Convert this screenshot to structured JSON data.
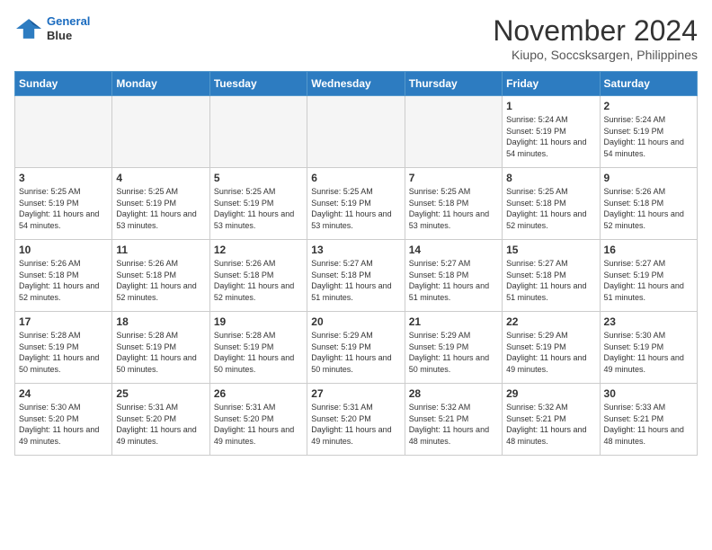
{
  "header": {
    "logo_line1": "General",
    "logo_line2": "Blue",
    "month": "November 2024",
    "location": "Kiupo, Soccsksargen, Philippines"
  },
  "weekdays": [
    "Sunday",
    "Monday",
    "Tuesday",
    "Wednesday",
    "Thursday",
    "Friday",
    "Saturday"
  ],
  "weeks": [
    [
      {
        "day": "",
        "info": ""
      },
      {
        "day": "",
        "info": ""
      },
      {
        "day": "",
        "info": ""
      },
      {
        "day": "",
        "info": ""
      },
      {
        "day": "",
        "info": ""
      },
      {
        "day": "1",
        "info": "Sunrise: 5:24 AM\nSunset: 5:19 PM\nDaylight: 11 hours\nand 54 minutes."
      },
      {
        "day": "2",
        "info": "Sunrise: 5:24 AM\nSunset: 5:19 PM\nDaylight: 11 hours\nand 54 minutes."
      }
    ],
    [
      {
        "day": "3",
        "info": "Sunrise: 5:25 AM\nSunset: 5:19 PM\nDaylight: 11 hours\nand 54 minutes."
      },
      {
        "day": "4",
        "info": "Sunrise: 5:25 AM\nSunset: 5:19 PM\nDaylight: 11 hours\nand 53 minutes."
      },
      {
        "day": "5",
        "info": "Sunrise: 5:25 AM\nSunset: 5:19 PM\nDaylight: 11 hours\nand 53 minutes."
      },
      {
        "day": "6",
        "info": "Sunrise: 5:25 AM\nSunset: 5:19 PM\nDaylight: 11 hours\nand 53 minutes."
      },
      {
        "day": "7",
        "info": "Sunrise: 5:25 AM\nSunset: 5:18 PM\nDaylight: 11 hours\nand 53 minutes."
      },
      {
        "day": "8",
        "info": "Sunrise: 5:25 AM\nSunset: 5:18 PM\nDaylight: 11 hours\nand 52 minutes."
      },
      {
        "day": "9",
        "info": "Sunrise: 5:26 AM\nSunset: 5:18 PM\nDaylight: 11 hours\nand 52 minutes."
      }
    ],
    [
      {
        "day": "10",
        "info": "Sunrise: 5:26 AM\nSunset: 5:18 PM\nDaylight: 11 hours\nand 52 minutes."
      },
      {
        "day": "11",
        "info": "Sunrise: 5:26 AM\nSunset: 5:18 PM\nDaylight: 11 hours\nand 52 minutes."
      },
      {
        "day": "12",
        "info": "Sunrise: 5:26 AM\nSunset: 5:18 PM\nDaylight: 11 hours\nand 52 minutes."
      },
      {
        "day": "13",
        "info": "Sunrise: 5:27 AM\nSunset: 5:18 PM\nDaylight: 11 hours\nand 51 minutes."
      },
      {
        "day": "14",
        "info": "Sunrise: 5:27 AM\nSunset: 5:18 PM\nDaylight: 11 hours\nand 51 minutes."
      },
      {
        "day": "15",
        "info": "Sunrise: 5:27 AM\nSunset: 5:18 PM\nDaylight: 11 hours\nand 51 minutes."
      },
      {
        "day": "16",
        "info": "Sunrise: 5:27 AM\nSunset: 5:19 PM\nDaylight: 11 hours\nand 51 minutes."
      }
    ],
    [
      {
        "day": "17",
        "info": "Sunrise: 5:28 AM\nSunset: 5:19 PM\nDaylight: 11 hours\nand 50 minutes."
      },
      {
        "day": "18",
        "info": "Sunrise: 5:28 AM\nSunset: 5:19 PM\nDaylight: 11 hours\nand 50 minutes."
      },
      {
        "day": "19",
        "info": "Sunrise: 5:28 AM\nSunset: 5:19 PM\nDaylight: 11 hours\nand 50 minutes."
      },
      {
        "day": "20",
        "info": "Sunrise: 5:29 AM\nSunset: 5:19 PM\nDaylight: 11 hours\nand 50 minutes."
      },
      {
        "day": "21",
        "info": "Sunrise: 5:29 AM\nSunset: 5:19 PM\nDaylight: 11 hours\nand 50 minutes."
      },
      {
        "day": "22",
        "info": "Sunrise: 5:29 AM\nSunset: 5:19 PM\nDaylight: 11 hours\nand 49 minutes."
      },
      {
        "day": "23",
        "info": "Sunrise: 5:30 AM\nSunset: 5:19 PM\nDaylight: 11 hours\nand 49 minutes."
      }
    ],
    [
      {
        "day": "24",
        "info": "Sunrise: 5:30 AM\nSunset: 5:20 PM\nDaylight: 11 hours\nand 49 minutes."
      },
      {
        "day": "25",
        "info": "Sunrise: 5:31 AM\nSunset: 5:20 PM\nDaylight: 11 hours\nand 49 minutes."
      },
      {
        "day": "26",
        "info": "Sunrise: 5:31 AM\nSunset: 5:20 PM\nDaylight: 11 hours\nand 49 minutes."
      },
      {
        "day": "27",
        "info": "Sunrise: 5:31 AM\nSunset: 5:20 PM\nDaylight: 11 hours\nand 49 minutes."
      },
      {
        "day": "28",
        "info": "Sunrise: 5:32 AM\nSunset: 5:21 PM\nDaylight: 11 hours\nand 48 minutes."
      },
      {
        "day": "29",
        "info": "Sunrise: 5:32 AM\nSunset: 5:21 PM\nDaylight: 11 hours\nand 48 minutes."
      },
      {
        "day": "30",
        "info": "Sunrise: 5:33 AM\nSunset: 5:21 PM\nDaylight: 11 hours\nand 48 minutes."
      }
    ]
  ]
}
